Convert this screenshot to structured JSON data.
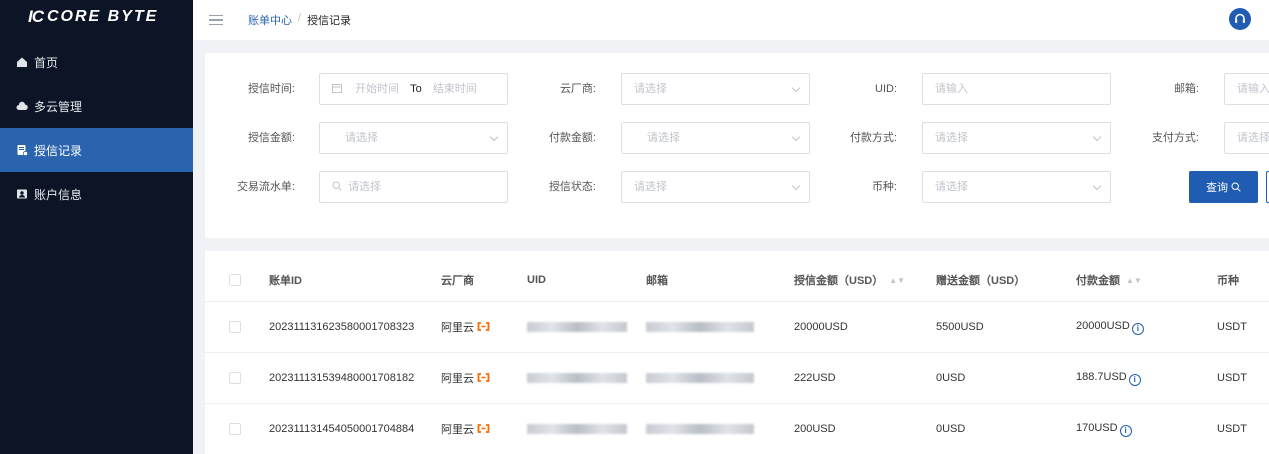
{
  "brand": {
    "mark": "IC",
    "name": "CORE BYTE"
  },
  "sidebar": {
    "items": [
      {
        "label": "首页",
        "icon": "home-icon",
        "active": false
      },
      {
        "label": "多云管理",
        "icon": "cloud-icon",
        "active": false
      },
      {
        "label": "授信记录",
        "icon": "credit-record-icon",
        "active": true
      },
      {
        "label": "账户信息",
        "icon": "account-icon",
        "active": false
      }
    ]
  },
  "header": {
    "breadcrumb": {
      "parent": "账单中心",
      "separator": "/",
      "current": "授信记录"
    }
  },
  "filters": {
    "credit_time": {
      "label": "授信时间:",
      "start_placeholder": "开始时间",
      "to": "To",
      "end_placeholder": "结束时间"
    },
    "cloud_vendor": {
      "label": "云厂商:",
      "placeholder": "请选择"
    },
    "uid": {
      "label": "UID:",
      "placeholder": "请输入"
    },
    "email": {
      "label": "邮箱:",
      "placeholder": "请输入"
    },
    "credit_amount": {
      "label": "授信金额:",
      "placeholder": "请选择"
    },
    "payment_amount": {
      "label": "付款金额:",
      "placeholder": "请选择"
    },
    "payment_method": {
      "label": "付款方式:",
      "placeholder": "请选择"
    },
    "pay_method": {
      "label": "支付方式:",
      "placeholder": "请选择"
    },
    "txn_no": {
      "label": "交易流水单:",
      "placeholder": "请选择"
    },
    "credit_status": {
      "label": "授信状态:",
      "placeholder": "请选择"
    },
    "currency": {
      "label": "币种:",
      "placeholder": "请选择"
    },
    "query_label": "查询"
  },
  "table": {
    "columns": [
      "账单ID",
      "云厂商",
      "UID",
      "邮箱",
      "授信金额（USD）",
      "赠送金额（USD）",
      "付款金额",
      "币种"
    ],
    "rows": [
      {
        "bill_id": "20231113162358000170832​3",
        "vendor": "阿里云",
        "credit": "20000USD",
        "bonus": "5500USD",
        "paid": "20000USD",
        "currency": "USDT"
      },
      {
        "bill_id": "20231113153948000170818​2",
        "vendor": "阿里云",
        "credit": "222USD",
        "bonus": "0USD",
        "paid": "188.7USD",
        "currency": "USDT"
      },
      {
        "bill_id": "20231113145405000170488​4",
        "vendor": "阿里云",
        "credit": "200USD",
        "bonus": "0USD",
        "paid": "170USD",
        "currency": "USDT"
      }
    ]
  },
  "colors": {
    "sidebar_bg": "#0c1526",
    "active_item": "#2a64ae",
    "primary": "#1f5cb2",
    "vendor_icon": "#ff6a00"
  }
}
